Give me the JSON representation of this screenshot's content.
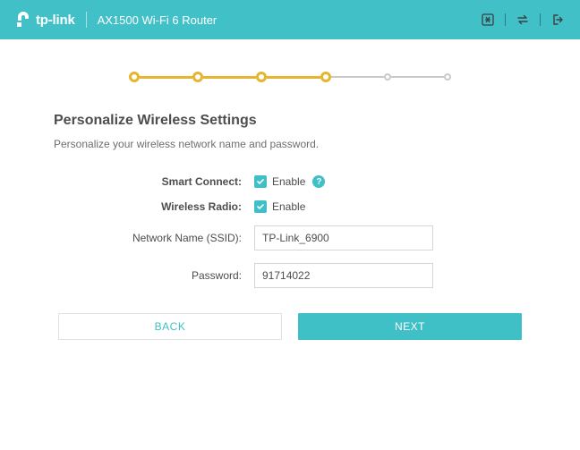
{
  "header": {
    "brand": "tp-link",
    "product": "AX1500 Wi-Fi 6 Router"
  },
  "page": {
    "title": "Personalize Wireless Settings",
    "subtitle": "Personalize your wireless network name and password."
  },
  "form": {
    "smart_connect_label": "Smart Connect:",
    "wireless_radio_label": "Wireless Radio:",
    "enable_label": "Enable",
    "ssid_label": "Network Name (SSID):",
    "ssid_value": "TP-Link_6900",
    "password_label": "Password:",
    "password_value": "91714022"
  },
  "buttons": {
    "back": "BACK",
    "next": "NEXT"
  }
}
